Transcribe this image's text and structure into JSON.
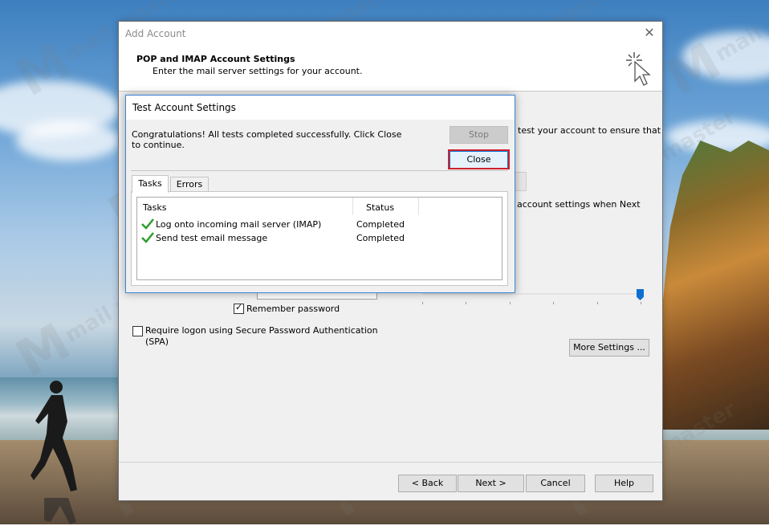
{
  "background": {
    "watermark": "mail master"
  },
  "main_dialog": {
    "title": "Add Account",
    "header_title": "POP and IMAP Account Settings",
    "header_subtitle": "Enter the mail server settings for your account.",
    "bg_text_test": "test your account to ensure that",
    "bg_text_next": "account settings when Next",
    "remember_password": "Remember password",
    "remember_checked": true,
    "spa_label_line1": "Require logon using Secure Password Authentication",
    "spa_label_line2": "(SPA)",
    "more_settings": "More Settings ...",
    "buttons": {
      "back": "< Back",
      "next": "Next >",
      "cancel": "Cancel",
      "help": "Help"
    }
  },
  "test_dialog": {
    "title": "Test Account Settings",
    "message": "Congratulations! All tests completed successfully. Click Close to continue.",
    "stop": "Stop",
    "close": "Close",
    "tabs": [
      "Tasks",
      "Errors"
    ],
    "columns": {
      "tasks": "Tasks",
      "status": "Status"
    },
    "rows": [
      {
        "task": "Log onto incoming mail server (IMAP)",
        "status": "Completed",
        "icon": "green-check-icon"
      },
      {
        "task": "Send test email message",
        "status": "Completed",
        "icon": "green-check-icon"
      }
    ]
  },
  "colors": {
    "accent_border": "#3c87d8",
    "highlight": "#d0212b",
    "check": "#2e9e2e"
  }
}
